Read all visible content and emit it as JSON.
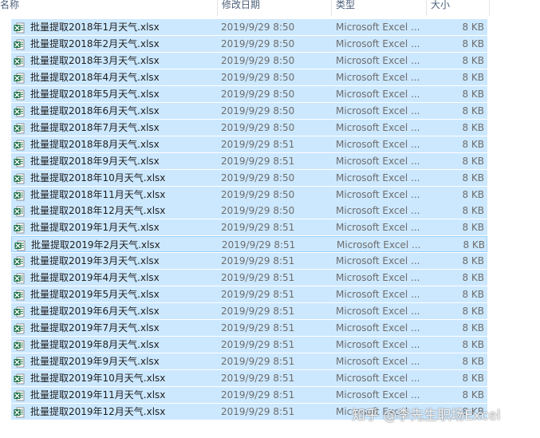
{
  "columns": {
    "name": "名称",
    "date": "修改日期",
    "type": "类型",
    "size": "大小"
  },
  "files": [
    {
      "name": "批量提取2018年1月天气.xlsx",
      "date": "2019/9/29 8:50",
      "type": "Microsoft Excel ...",
      "size": "8 KB"
    },
    {
      "name": "批量提取2018年2月天气.xlsx",
      "date": "2019/9/29 8:50",
      "type": "Microsoft Excel ...",
      "size": "8 KB"
    },
    {
      "name": "批量提取2018年3月天气.xlsx",
      "date": "2019/9/29 8:50",
      "type": "Microsoft Excel ...",
      "size": "8 KB"
    },
    {
      "name": "批量提取2018年4月天气.xlsx",
      "date": "2019/9/29 8:50",
      "type": "Microsoft Excel ...",
      "size": "8 KB"
    },
    {
      "name": "批量提取2018年5月天气.xlsx",
      "date": "2019/9/29 8:50",
      "type": "Microsoft Excel ...",
      "size": "8 KB"
    },
    {
      "name": "批量提取2018年6月天气.xlsx",
      "date": "2019/9/29 8:50",
      "type": "Microsoft Excel ...",
      "size": "8 KB"
    },
    {
      "name": "批量提取2018年7月天气.xlsx",
      "date": "2019/9/29 8:50",
      "type": "Microsoft Excel ...",
      "size": "8 KB"
    },
    {
      "name": "批量提取2018年8月天气.xlsx",
      "date": "2019/9/29 8:51",
      "type": "Microsoft Excel ...",
      "size": "8 KB"
    },
    {
      "name": "批量提取2018年9月天气.xlsx",
      "date": "2019/9/29 8:51",
      "type": "Microsoft Excel ...",
      "size": "8 KB"
    },
    {
      "name": "批量提取2018年10月天气.xlsx",
      "date": "2019/9/29 8:50",
      "type": "Microsoft Excel ...",
      "size": "8 KB"
    },
    {
      "name": "批量提取2018年11月天气.xlsx",
      "date": "2019/9/29 8:50",
      "type": "Microsoft Excel ...",
      "size": "8 KB"
    },
    {
      "name": "批量提取2018年12月天气.xlsx",
      "date": "2019/9/29 8:50",
      "type": "Microsoft Excel ...",
      "size": "8 KB"
    },
    {
      "name": "批量提取2019年1月天气.xlsx",
      "date": "2019/9/29 8:51",
      "type": "Microsoft Excel ...",
      "size": "8 KB"
    },
    {
      "name": "批量提取2019年2月天气.xlsx",
      "date": "2019/9/29 8:51",
      "type": "Microsoft Excel ...",
      "size": "8 KB"
    },
    {
      "name": "批量提取2019年3月天气.xlsx",
      "date": "2019/9/29 8:51",
      "type": "Microsoft Excel ...",
      "size": "8 KB"
    },
    {
      "name": "批量提取2019年4月天气.xlsx",
      "date": "2019/9/29 8:51",
      "type": "Microsoft Excel ...",
      "size": "8 KB"
    },
    {
      "name": "批量提取2019年5月天气.xlsx",
      "date": "2019/9/29 8:51",
      "type": "Microsoft Excel ...",
      "size": "8 KB"
    },
    {
      "name": "批量提取2019年6月天气.xlsx",
      "date": "2019/9/29 8:51",
      "type": "Microsoft Excel ...",
      "size": "8 KB"
    },
    {
      "name": "批量提取2019年7月天气.xlsx",
      "date": "2019/9/29 8:51",
      "type": "Microsoft Excel ...",
      "size": "8 KB"
    },
    {
      "name": "批量提取2019年8月天气.xlsx",
      "date": "2019/9/29 8:51",
      "type": "Microsoft Excel ...",
      "size": "8 KB"
    },
    {
      "name": "批量提取2019年9月天气.xlsx",
      "date": "2019/9/29 8:51",
      "type": "Microsoft Excel ...",
      "size": "8 KB"
    },
    {
      "name": "批量提取2019年10月天气.xlsx",
      "date": "2019/9/29 8:51",
      "type": "Microsoft Excel ...",
      "size": "8 KB"
    },
    {
      "name": "批量提取2019年11月天气.xlsx",
      "date": "2019/9/29 8:51",
      "type": "Microsoft Excel ...",
      "size": "8 KB"
    },
    {
      "name": "批量提取2019年12月天气.xlsx",
      "date": "2019/9/29 8:51",
      "type": "Microsoft Excel ...",
      "size": "8 KB"
    }
  ],
  "focused_row_index": 13,
  "file_icon": "excel-file-icon",
  "colors": {
    "selection": "#cce8ff",
    "focus_border": "#99d1ff",
    "excel_green": "#1e7145"
  },
  "watermark": "知乎 @李先生职场Excel"
}
